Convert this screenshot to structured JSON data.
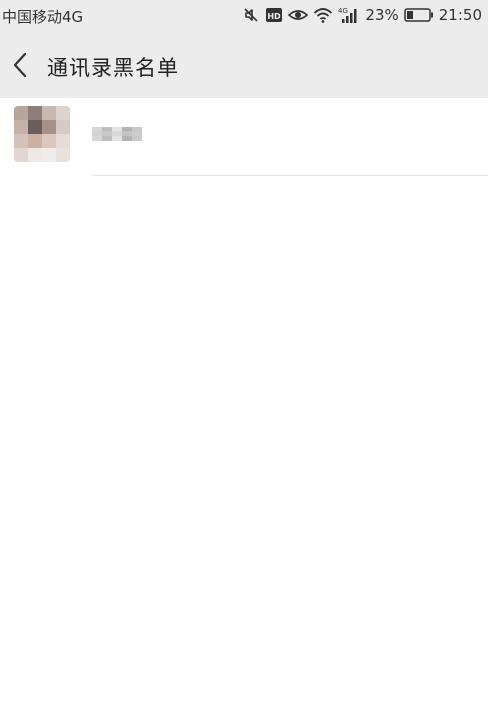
{
  "status_bar": {
    "carrier": "中国移动4G",
    "network_badge": "4G",
    "hd_badge": "HD",
    "battery": "23%",
    "time": "21:50",
    "icons": [
      "mute-icon",
      "hd-icon",
      "eye-icon",
      "wifi-icon",
      "signal-icon",
      "battery-icon"
    ]
  },
  "header": {
    "back_icon": "chevron-left-icon",
    "title": "通讯录黑名单"
  },
  "contacts": [
    {
      "name": ""
    }
  ],
  "colors": {
    "bar_background": "#ececec",
    "page_background": "#ffffff",
    "divider": "#e6e6e6"
  }
}
